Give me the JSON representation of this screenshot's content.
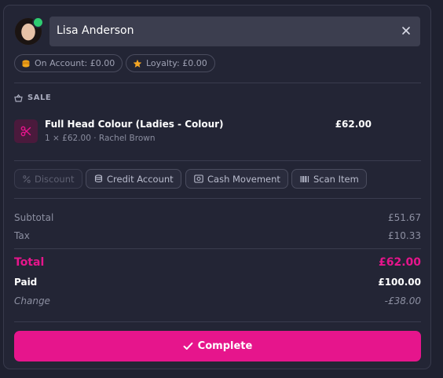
{
  "customer": {
    "name": "Lisa Anderson",
    "online": true
  },
  "badges": {
    "on_account": "On Account: £0.00",
    "loyalty": "Loyalty: £0.00"
  },
  "sale": {
    "section_title": "SALE",
    "items": [
      {
        "title": "Full Head Colour (Ladies - Colour)",
        "detail": "1 × £62.00 · Rachel Brown",
        "price": "£62.00",
        "icon": "scissors-icon"
      }
    ]
  },
  "actions": {
    "discount": "Discount",
    "credit_account": "Credit Account",
    "cash_movement": "Cash Movement",
    "scan_item": "Scan Item"
  },
  "summary": {
    "subtotal_label": "Subtotal",
    "subtotal_value": "£51.67",
    "tax_label": "Tax",
    "tax_value": "£10.33",
    "total_label": "Total",
    "total_value": "£62.00",
    "paid_label": "Paid",
    "paid_value": "£100.00",
    "change_label": "Change",
    "change_value": "-£38.00"
  },
  "complete_button": {
    "label": "Complete"
  },
  "colors": {
    "accent": "#e6158c",
    "background": "#232535",
    "online": "#2ecc71"
  }
}
